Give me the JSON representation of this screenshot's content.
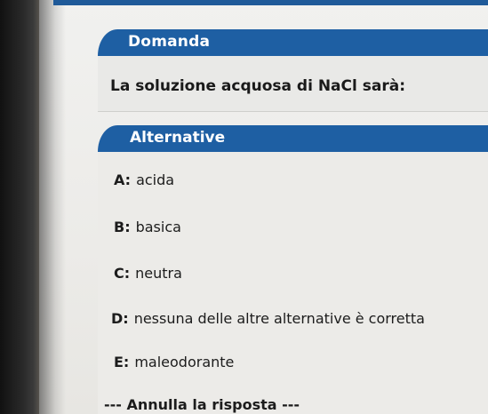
{
  "question": {
    "header": "Domanda",
    "text": "La soluzione acquosa di NaCl sarà:"
  },
  "alternatives": {
    "header": "Alternative",
    "options": [
      {
        "letter": "A:",
        "text": "acida"
      },
      {
        "letter": "B:",
        "text": "basica"
      },
      {
        "letter": "C:",
        "text": "neutra"
      },
      {
        "letter": "D:",
        "text": "nessuna delle altre alternative è corretta"
      },
      {
        "letter": "E:",
        "text": "maleodorante"
      }
    ]
  },
  "cancel_label": "--- Annulla la risposta ---",
  "colors": {
    "header_blue": "#1e5fa3",
    "background": "#ecebe8"
  }
}
